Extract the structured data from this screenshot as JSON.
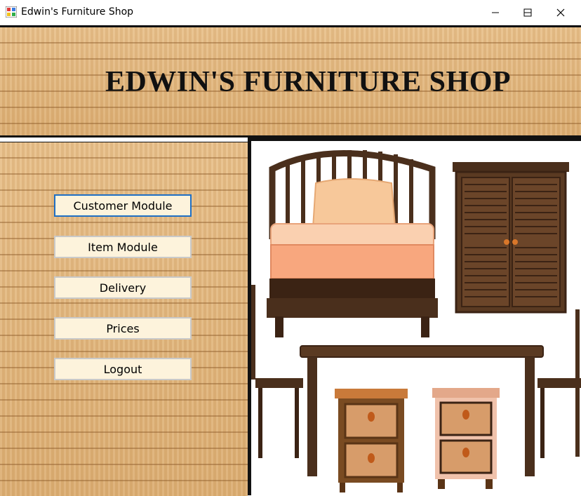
{
  "window": {
    "title": "Edwin's Furniture Shop",
    "controls": [
      "minimize-icon",
      "maximize-icon",
      "close-icon"
    ]
  },
  "banner": {
    "title": "EDWIN'S FURNITURE SHOP"
  },
  "menu": {
    "items": [
      {
        "label": "Customer Module",
        "focused": true
      },
      {
        "label": "Item Module",
        "focused": false
      },
      {
        "label": "Delivery",
        "focused": false
      },
      {
        "label": "Prices",
        "focused": false
      },
      {
        "label": "Logout",
        "focused": false
      }
    ]
  },
  "picture": {
    "items": [
      "bed-illustration",
      "wardrobe-illustration",
      "dining-table-illustration",
      "chair-illustration",
      "drawer-illustration"
    ]
  },
  "colors": {
    "focus_border": "#1f6fc4",
    "button_face": "#fdf3dc",
    "wood": "#e3b77f",
    "dark_wood": "#4a2f1c"
  }
}
